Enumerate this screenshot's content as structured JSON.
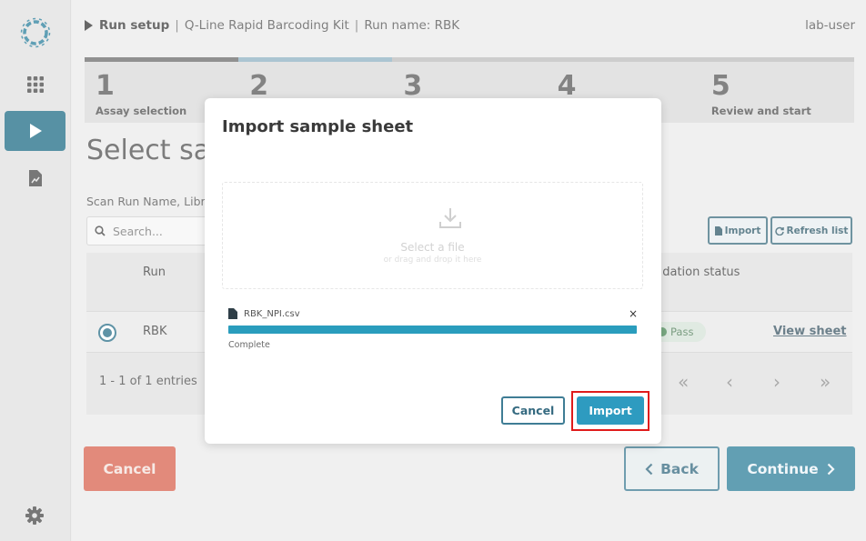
{
  "header": {
    "breadcrumb_primary": "Run setup",
    "kit": "Q-Line Rapid Barcoding Kit",
    "run_name": "Run name: RBK",
    "separator": "|",
    "user": "lab-user"
  },
  "steps": [
    {
      "num": "1",
      "label": "Assay selection",
      "state": "done"
    },
    {
      "num": "2",
      "label": "",
      "state": "current"
    },
    {
      "num": "3",
      "label": "",
      "state": "todo"
    },
    {
      "num": "4",
      "label": "",
      "state": "todo"
    },
    {
      "num": "5",
      "label": "Review and start",
      "state": "todo"
    }
  ],
  "page": {
    "title": "Select sar",
    "scan_label": "Scan Run Name, Libr",
    "search_placeholder": "Search...",
    "import_label": "Import",
    "refresh_label": "Refresh list"
  },
  "table": {
    "col_run": "Run",
    "col_validation": "lidation status",
    "rows": [
      {
        "run": "RBK",
        "status": "Pass",
        "action": "View sheet",
        "selected": true
      }
    ],
    "entries": "1 - 1 of 1 entries",
    "pager": [
      "«",
      "‹",
      "›",
      "»"
    ]
  },
  "footer": {
    "cancel": "Cancel",
    "back": "Back",
    "continue": "Continue"
  },
  "modal": {
    "title": "Import sample sheet",
    "dropzone_title": "Select a file",
    "dropzone_sub": "or drag and drop it here",
    "file_name": "RBK_NPI.csv",
    "remove": "×",
    "progress": 1.0,
    "status": "Complete",
    "cancel": "Cancel",
    "import": "Import"
  },
  "colors": {
    "accent": "#2e7f9a",
    "danger": "#d9634f",
    "progress": "#2a9dbd",
    "highlight": "#e01b1b"
  },
  "icons": {
    "logo": "logo-icon",
    "apps": "apps-grid-icon",
    "run": "play-icon",
    "doc": "document-chart-icon",
    "settings": "gear-icon",
    "search": "search-icon",
    "upload": "download-tray-icon"
  }
}
